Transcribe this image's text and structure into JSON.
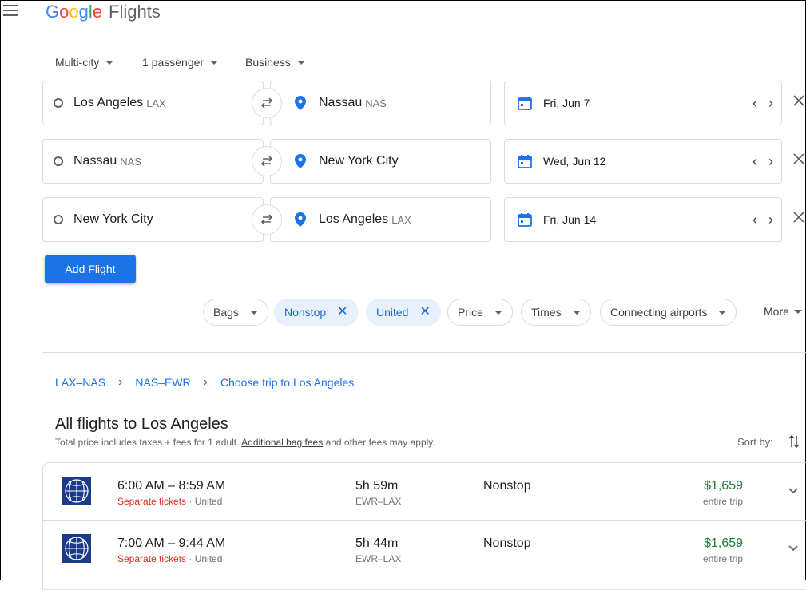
{
  "header": {
    "logo_letters": [
      "G",
      "o",
      "o",
      "g",
      "l",
      "e"
    ],
    "product": "Flights"
  },
  "options": {
    "trip_type": "Multi-city",
    "passengers": "1 passenger",
    "cabin": "Business"
  },
  "legs": [
    {
      "origin": "Los Angeles",
      "origin_code": "LAX",
      "destination": "Nassau",
      "destination_code": "NAS",
      "date": "Fri, Jun 7"
    },
    {
      "origin": "Nassau",
      "origin_code": "NAS",
      "destination": "New York City",
      "destination_code": "",
      "date": "Wed, Jun 12"
    },
    {
      "origin": "New York City",
      "origin_code": "",
      "destination": "Los Angeles",
      "destination_code": "LAX",
      "date": "Fri, Jun 14"
    }
  ],
  "add_flight_label": "Add Flight",
  "filters": [
    {
      "label": "Bags",
      "selected": false
    },
    {
      "label": "Nonstop",
      "selected": true
    },
    {
      "label": "United",
      "selected": true
    },
    {
      "label": "Price",
      "selected": false
    },
    {
      "label": "Times",
      "selected": false
    },
    {
      "label": "Connecting airports",
      "selected": false
    }
  ],
  "more_label": "More",
  "breadcrumbs": [
    "LAX–NAS",
    "NAS–EWR",
    "Choose trip to Los Angeles"
  ],
  "section": {
    "title": "All flights to Los Angeles",
    "subtitle_prefix": "Total price includes taxes + fees for 1 adult.",
    "subtitle_link": "Additional bag fees",
    "subtitle_suffix": "and other fees may apply.",
    "sort_label": "Sort by:"
  },
  "flights": [
    {
      "times": "6:00 AM – 8:59 AM",
      "ticket_note": "Separate tickets",
      "airline": "United",
      "duration": "5h 59m",
      "route": "EWR–LAX",
      "stops": "Nonstop",
      "price": "$1,659",
      "price_type": "entire trip"
    },
    {
      "times": "7:00 AM – 9:44 AM",
      "ticket_note": "Separate tickets",
      "airline": "United",
      "duration": "5h 44m",
      "route": "EWR–LAX",
      "stops": "Nonstop",
      "price": "$1,659",
      "price_type": "entire trip"
    }
  ],
  "colors": {
    "accent": "#1a73e8",
    "price_green": "#188038",
    "warning_red": "#d93025",
    "chip_selected_bg": "#e8f0fe"
  }
}
